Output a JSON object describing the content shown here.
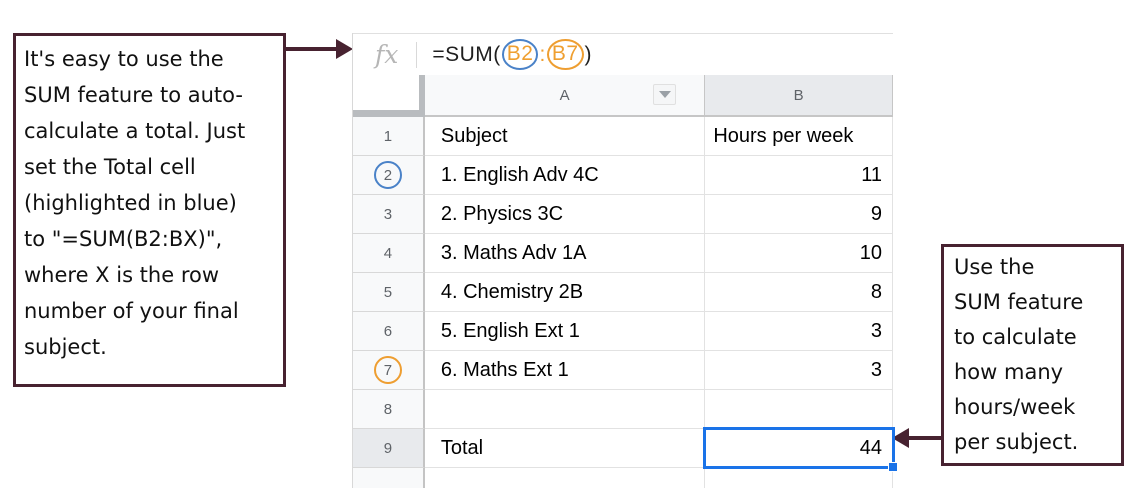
{
  "annotations": {
    "left_box": {
      "lines": [
        "It's easy to use the",
        "SUM feature to auto-",
        "calculate a total. Just",
        "set the Total cell",
        "(highlighted in blue)",
        "to \"=SUM(B2:BX)\",",
        "where X is the row",
        "number of your final",
        "subject."
      ]
    },
    "right_box": {
      "lines": [
        "Use the",
        "SUM feature",
        "to calculate",
        "how many",
        "hours/week",
        "per subject."
      ]
    }
  },
  "formula_bar": {
    "fx_label": "fx",
    "formula_prefix": "=SUM(",
    "ref_start": "B2",
    "separator": ":",
    "ref_end": "B7",
    "formula_suffix": ")"
  },
  "spreadsheet": {
    "columns": [
      {
        "label": "A"
      },
      {
        "label": "B"
      }
    ],
    "rows": [
      {
        "num": "1",
        "a": "Subject",
        "b": "Hours per week"
      },
      {
        "num": "2",
        "a": "1. English Adv 4C",
        "b": "11"
      },
      {
        "num": "3",
        "a": "2. Physics 3C",
        "b": "9"
      },
      {
        "num": "4",
        "a": "3. Maths Adv 1A",
        "b": "10"
      },
      {
        "num": "5",
        "a": "4. Chemistry 2B",
        "b": "8"
      },
      {
        "num": "6",
        "a": "5. English Ext 1",
        "b": "3"
      },
      {
        "num": "7",
        "a": "6. Maths Ext 1",
        "b": "3"
      },
      {
        "num": "8",
        "a": "",
        "b": ""
      },
      {
        "num": "9",
        "a": "Total",
        "b": "44"
      }
    ],
    "selected_cell": "B9"
  },
  "colors": {
    "annotation_border": "#472230",
    "selection_blue": "#1a73e8",
    "circle_blue": "#4a82c8",
    "circle_orange": "#ee9e31",
    "formula_range_orange": "#ef9f30",
    "column_header_bg": "#f8f9fa",
    "column_header_selected_bg": "#e8eaed",
    "gridline": "#e2e2e2"
  }
}
